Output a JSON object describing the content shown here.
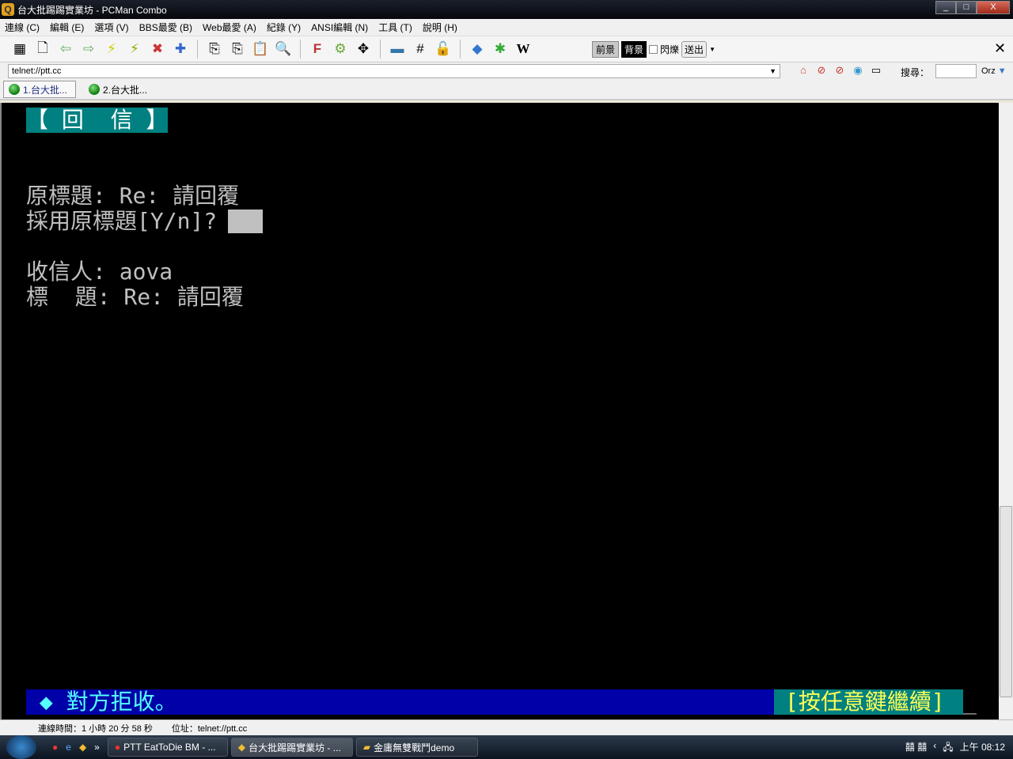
{
  "window": {
    "title": "台大批踢踢實業坊 - PCMan Combo",
    "min": "_",
    "max": "□",
    "close": "X"
  },
  "menu": [
    "連線 (C)",
    "編輯 (E)",
    "選項 (V)",
    "BBS最愛 (B)",
    "Web最愛 (A)",
    "紀錄 (Y)",
    "ANSI編輯 (N)",
    "工具 (T)",
    "說明 (H)"
  ],
  "colorbar": {
    "fg": "前景",
    "bg": "背景",
    "blink": "閃爍",
    "send": "送出"
  },
  "address": {
    "value": "telnet://ptt.cc"
  },
  "search": {
    "label": "搜尋：",
    "engine": "Orz"
  },
  "tabs": [
    "1.台大批...",
    "2.台大批..."
  ],
  "terminal": {
    "header": "【 回  信 】",
    "orig_title": "原標題: Re: 請回覆",
    "use_orig": "採用原標題[Y/n]? ",
    "recipient": "收信人: aova",
    "subject": "標  題: Re: 請回覆",
    "status_msg": " ◆ 對方拒收。",
    "continue": "[按任意鍵繼續]",
    "cursor": "_"
  },
  "statusbar": {
    "conn_time": "連線時間：1 小時 20 分 58 秒",
    "address": "位址：telnet://ptt.cc"
  },
  "taskbar": {
    "items": [
      "PTT EatToDie BM - ...",
      "台大批踢踢實業坊 - ...",
      "金庸無雙戰鬥demo"
    ],
    "clock": "上午 08:12",
    "tray": "囍 囍"
  }
}
